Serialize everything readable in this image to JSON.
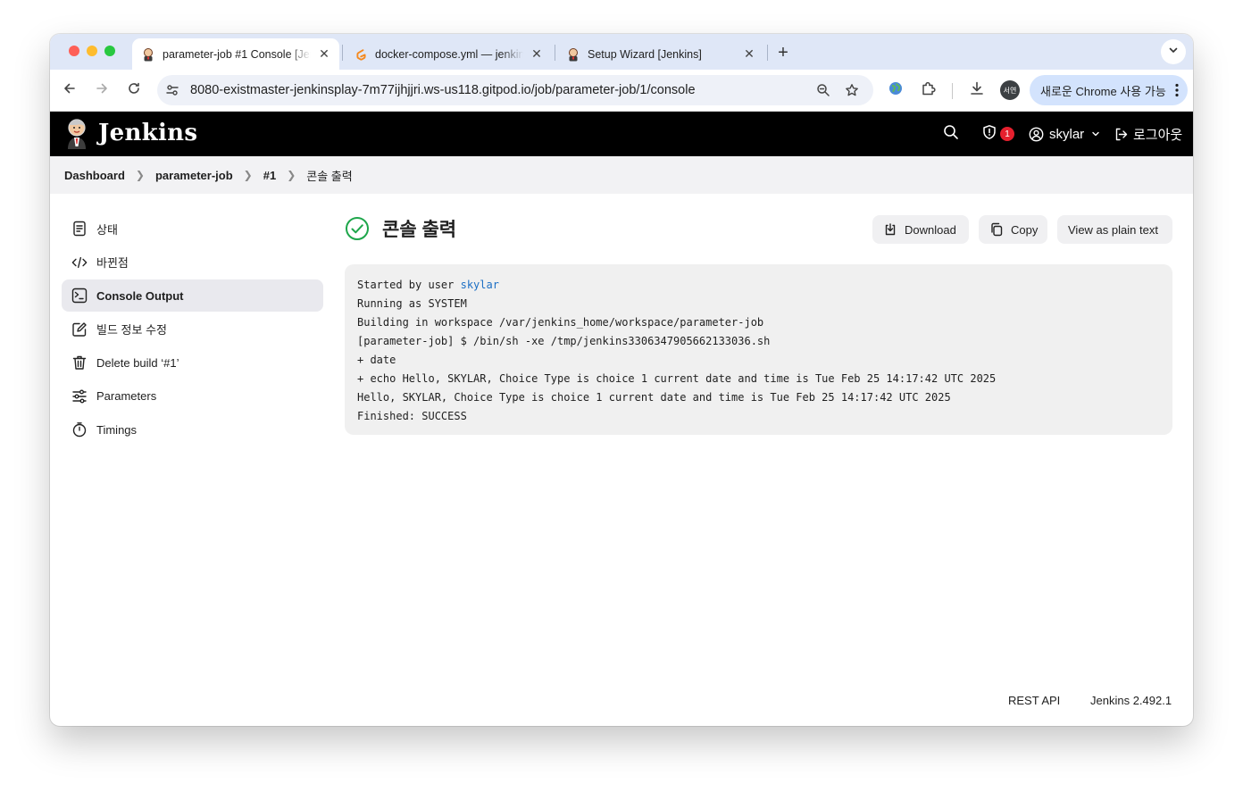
{
  "browser": {
    "tabs": [
      {
        "title": "parameter-job #1 Console [Jenkins]",
        "favicon": "jenkins-butler-icon",
        "active": true
      },
      {
        "title": "docker-compose.yml — jenkins",
        "favicon": "gitpod-icon",
        "active": false
      },
      {
        "title": "Setup Wizard [Jenkins]",
        "favicon": "jenkins-butler-icon",
        "active": false
      }
    ],
    "url": "8080-existmaster-jenkinsplay-7m77ijhjjri.ws-us118.gitpod.io/job/parameter-job/1/console",
    "profile_initials": "서연",
    "chrome_update_label": "새로운 Chrome 사용 가능"
  },
  "jenkins": {
    "brand": "Jenkins",
    "security_badge_count": "1",
    "user_name": "skylar",
    "logout_label": "로그아웃"
  },
  "breadcrumb": [
    "Dashboard",
    "parameter-job",
    "#1",
    "콘솔 출력"
  ],
  "sidebar": {
    "items": [
      {
        "label": "상태",
        "icon": "document-icon",
        "active": false
      },
      {
        "label": "바뀐점",
        "icon": "code-icon",
        "active": false
      },
      {
        "label": "Console Output",
        "icon": "terminal-icon",
        "active": true
      },
      {
        "label": "빌드 정보 수정",
        "icon": "edit-icon",
        "active": false
      },
      {
        "label": "Delete build ‘#1’",
        "icon": "trash-icon",
        "active": false
      },
      {
        "label": "Parameters",
        "icon": "sliders-icon",
        "active": false
      },
      {
        "label": "Timings",
        "icon": "stopwatch-icon",
        "active": false
      }
    ]
  },
  "main": {
    "title": "콘솔 출력",
    "status_icon": "success-check-icon",
    "buttons": {
      "download": "Download",
      "copy": "Copy",
      "plain_text": "View as plain text"
    },
    "console": {
      "started_prefix": "Started by user ",
      "started_user": "skylar",
      "lines": [
        "Running as SYSTEM",
        "Building in workspace /var/jenkins_home/workspace/parameter-job",
        "[parameter-job] $ /bin/sh -xe /tmp/jenkins3306347905662133036.sh",
        "+ date",
        "+ echo Hello, SKYLAR, Choice Type is choice 1 current date and time is Tue Feb 25 14:17:42 UTC 2025",
        "Hello, SKYLAR, Choice Type is choice 1 current date and time is Tue Feb 25 14:17:42 UTC 2025",
        "Finished: SUCCESS"
      ]
    }
  },
  "footer": {
    "rest_api": "REST API",
    "version": "Jenkins 2.492.1"
  },
  "colors": {
    "success": "#1ea64b",
    "link": "#1c6fc4",
    "badge": "#e5202e",
    "header_bg": "#000000"
  }
}
